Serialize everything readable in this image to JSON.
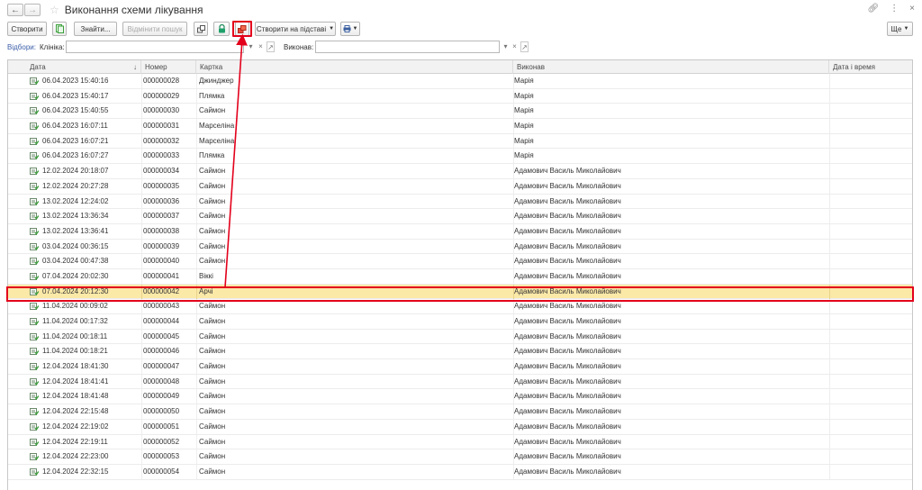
{
  "window": {
    "title": "Виконання схеми лікування"
  },
  "toolbar": {
    "create_label": "Створити",
    "find_label": "Знайти...",
    "cancel_search_label": "Відмінити пошук",
    "create_based_label": "Створити на підставі",
    "more_label": "Ще"
  },
  "filters": {
    "filter_label": "Відбори:",
    "clinic_label": "Клініка:",
    "clinic_value": "",
    "executor_label": "Виконав:",
    "executor_value": ""
  },
  "table": {
    "columns": [
      "Дата",
      "Номер",
      "Картка",
      "Виконав",
      "Дата і время"
    ],
    "rows": [
      {
        "date": "06.04.2023 15:40:16",
        "number": "000000028",
        "card": "Джинджер",
        "executor": "Марія",
        "datetime": ""
      },
      {
        "date": "06.04.2023 15:40:17",
        "number": "000000029",
        "card": "Плямка",
        "executor": "Марія",
        "datetime": ""
      },
      {
        "date": "06.04.2023 15:40:55",
        "number": "000000030",
        "card": "Саймон",
        "executor": "Марія",
        "datetime": ""
      },
      {
        "date": "06.04.2023 16:07:11",
        "number": "000000031",
        "card": "Марселіна",
        "executor": "Марія",
        "datetime": ""
      },
      {
        "date": "06.04.2023 16:07:21",
        "number": "000000032",
        "card": "Марселіна",
        "executor": "Марія",
        "datetime": ""
      },
      {
        "date": "06.04.2023 16:07:27",
        "number": "000000033",
        "card": "Плямка",
        "executor": "Марія",
        "datetime": ""
      },
      {
        "date": "12.02.2024 20:18:07",
        "number": "000000034",
        "card": "Саймон",
        "executor": "Адамович Василь Миколайович",
        "datetime": ""
      },
      {
        "date": "12.02.2024 20:27:28",
        "number": "000000035",
        "card": "Саймон",
        "executor": "Адамович Василь Миколайович",
        "datetime": ""
      },
      {
        "date": "13.02.2024 12:24:02",
        "number": "000000036",
        "card": "Саймон",
        "executor": "Адамович Василь Миколайович",
        "datetime": ""
      },
      {
        "date": "13.02.2024 13:36:34",
        "number": "000000037",
        "card": "Саймон",
        "executor": "Адамович Василь Миколайович",
        "datetime": ""
      },
      {
        "date": "13.02.2024 13:36:41",
        "number": "000000038",
        "card": "Саймон",
        "executor": "Адамович Василь Миколайович",
        "datetime": ""
      },
      {
        "date": "03.04.2024 00:36:15",
        "number": "000000039",
        "card": "Саймон",
        "executor": "Адамович Василь Миколайович",
        "datetime": ""
      },
      {
        "date": "03.04.2024 00:47:38",
        "number": "000000040",
        "card": "Саймон",
        "executor": "Адамович Василь Миколайович",
        "datetime": ""
      },
      {
        "date": "07.04.2024 20:02:30",
        "number": "000000041",
        "card": "Віккі",
        "executor": "Адамович Василь Миколайович",
        "datetime": ""
      },
      {
        "date": "07.04.2024 20:12:30",
        "number": "000000042",
        "card": "Арчі",
        "executor": "Адамович Василь Миколайович",
        "datetime": "",
        "selected": true
      },
      {
        "date": "11.04.2024 00:09:02",
        "number": "000000043",
        "card": "Саймон",
        "executor": "Адамович Василь Миколайович",
        "datetime": ""
      },
      {
        "date": "11.04.2024 00:17:32",
        "number": "000000044",
        "card": "Саймон",
        "executor": "Адамович Василь Миколайович",
        "datetime": ""
      },
      {
        "date": "11.04.2024 00:18:11",
        "number": "000000045",
        "card": "Саймон",
        "executor": "Адамович Василь Миколайович",
        "datetime": ""
      },
      {
        "date": "11.04.2024 00:18:21",
        "number": "000000046",
        "card": "Саймон",
        "executor": "Адамович Василь Миколайович",
        "datetime": ""
      },
      {
        "date": "12.04.2024 18:41:30",
        "number": "000000047",
        "card": "Саймон",
        "executor": "Адамович Василь Миколайович",
        "datetime": ""
      },
      {
        "date": "12.04.2024 18:41:41",
        "number": "000000048",
        "card": "Саймон",
        "executor": "Адамович Василь Миколайович",
        "datetime": ""
      },
      {
        "date": "12.04.2024 18:41:48",
        "number": "000000049",
        "card": "Саймон",
        "executor": "Адамович Василь Миколайович",
        "datetime": ""
      },
      {
        "date": "12.04.2024 22:15:48",
        "number": "000000050",
        "card": "Саймон",
        "executor": "Адамович Василь Миколайович",
        "datetime": ""
      },
      {
        "date": "12.04.2024 22:19:02",
        "number": "000000051",
        "card": "Саймон",
        "executor": "Адамович Василь Миколайович",
        "datetime": ""
      },
      {
        "date": "12.04.2024 22:19:11",
        "number": "000000052",
        "card": "Саймон",
        "executor": "Адамович Василь Миколайович",
        "datetime": ""
      },
      {
        "date": "12.04.2024 22:23:00",
        "number": "000000053",
        "card": "Саймон",
        "executor": "Адамович Василь Миколайович",
        "datetime": ""
      },
      {
        "date": "12.04.2024 22:32:15",
        "number": "000000054",
        "card": "Саймон",
        "executor": "Адамович Василь Миколайович",
        "datetime": ""
      }
    ]
  },
  "colors": {
    "annotation_red": "#e3001b",
    "selected_row": "#fbe9a8",
    "link_blue": "#3a5ea8",
    "doc_icon_green": "#3aa03a"
  },
  "icons": {
    "back": "arrow-left-icon",
    "forward": "arrow-right-icon",
    "favorite": "star-icon",
    "link": "chain-link-icon",
    "more_menu": "kebab-icon",
    "close": "close-icon",
    "copy_green": "document-copy-icon",
    "link_tb": "link-icon",
    "lock": "lock-icon",
    "red_docs": "related-documents-icon",
    "print": "printer-icon",
    "row_doc": "posted-document-icon"
  }
}
